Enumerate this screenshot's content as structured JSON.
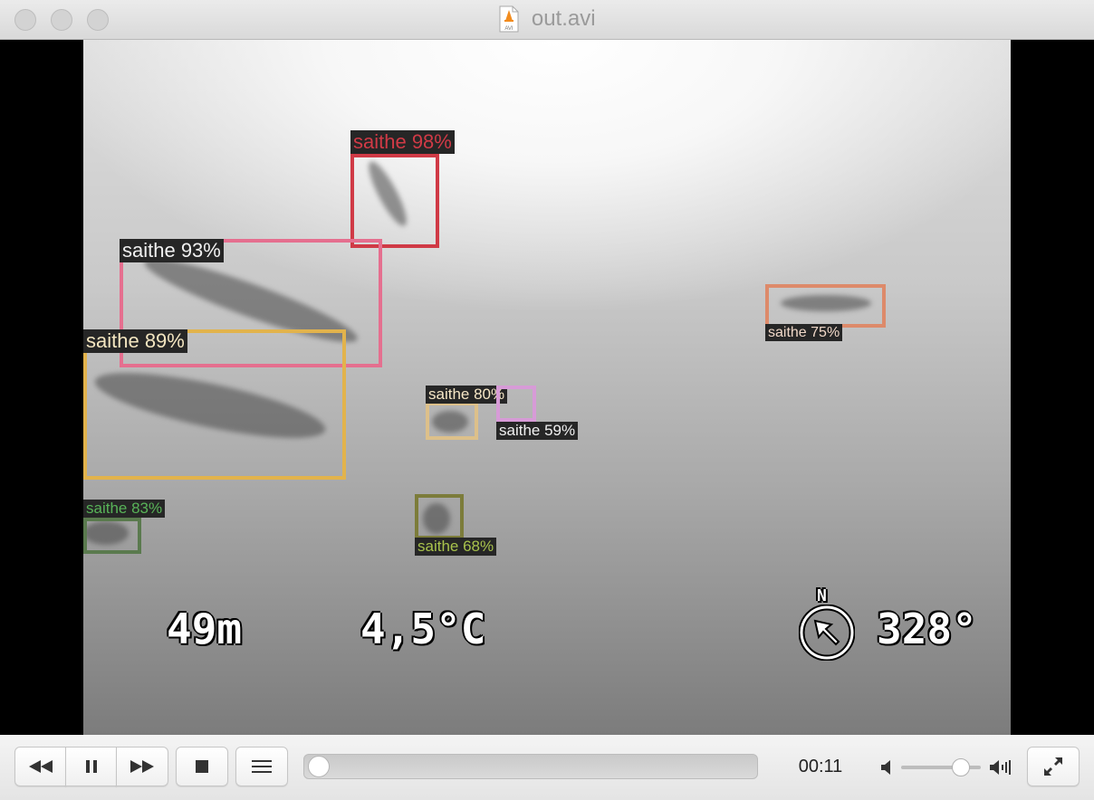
{
  "window": {
    "title": "out.avi",
    "file_icon_text": "AVI"
  },
  "detections": [
    {
      "label": "saithe 98%",
      "color": "#d03a46"
    },
    {
      "label": "saithe 93%",
      "color": "#e56f8f"
    },
    {
      "label": "saithe 89%",
      "color": "#e2b34c"
    },
    {
      "label": "saithe 75%",
      "color": "#dd8a6a"
    },
    {
      "label": "saithe 80%",
      "color": "#ddc08a"
    },
    {
      "label": "saithe 59%",
      "color": "#d79bd7"
    },
    {
      "label": "saithe 83%",
      "color": "#58b358"
    },
    {
      "label": "saithe 68%",
      "color": "#a8c24c"
    }
  ],
  "overlay": {
    "depth": "49m",
    "temperature": "4,5°C",
    "compass_letter": "N",
    "heading": "328°"
  },
  "controls": {
    "rewind_icon": "rewind-icon",
    "pause_icon": "pause-icon",
    "forward_icon": "fast-forward-icon",
    "stop_icon": "stop-icon",
    "playlist_icon": "playlist-icon",
    "time": "00:11",
    "progress": 0,
    "volume": 0.75,
    "fullscreen_icon": "fullscreen-icon"
  }
}
